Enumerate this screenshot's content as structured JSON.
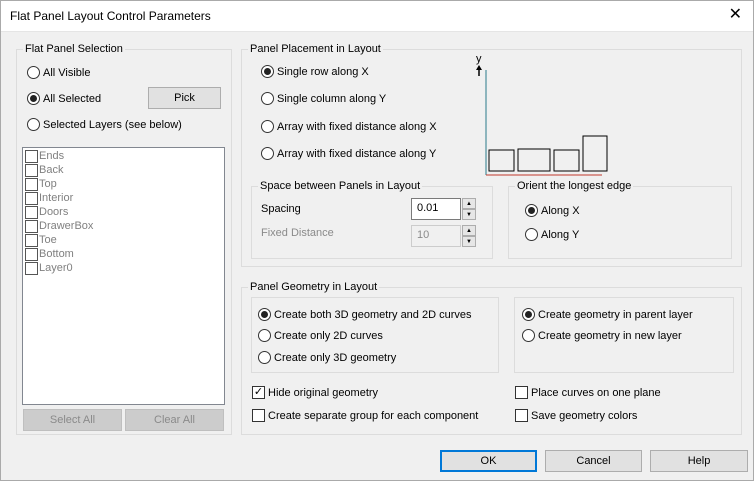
{
  "window": {
    "title": "Flat Panel Layout Control Parameters",
    "close_glyph": "✕"
  },
  "selection": {
    "title": "Flat Panel Selection",
    "all_visible": "All Visible",
    "all_selected": "All Selected",
    "pick_button": "Pick",
    "selected_layers": "Selected Layers (see below)",
    "layers": [
      "Ends",
      "Back",
      "Top",
      "Interior",
      "Doors",
      "DrawerBox",
      "Toe",
      "Bottom",
      "Layer0"
    ],
    "select_all": "Select All",
    "clear_all": "Clear All"
  },
  "placement": {
    "title": "Panel Placement in Layout",
    "single_row": "Single row along X",
    "single_column": "Single column along Y",
    "array_x": "Array with fixed distance along X",
    "array_y": "Array with fixed distance along Y",
    "axis_label": "y"
  },
  "spacing": {
    "title": "Space between Panels in Layout",
    "spacing_label": "Spacing",
    "spacing_value": "0.01",
    "fixed_label": "Fixed Distance",
    "fixed_value": "10"
  },
  "orient": {
    "title": "Orient the longest edge",
    "along_x": "Along X",
    "along_y": "Along Y"
  },
  "geometry": {
    "title": "Panel Geometry in Layout",
    "both": "Create both 3D geometry and 2D curves",
    "only_2d": "Create only 2D curves",
    "only_3d": "Create only 3D geometry",
    "parent_layer": "Create geometry in parent layer",
    "new_layer": "Create geometry in new layer",
    "hide_original": "Hide original geometry",
    "separate_group": "Create separate group for each component",
    "one_plane": "Place curves on one plane",
    "save_colors": "Save geometry colors"
  },
  "footer": {
    "ok": "OK",
    "cancel": "Cancel",
    "help": "Help"
  }
}
